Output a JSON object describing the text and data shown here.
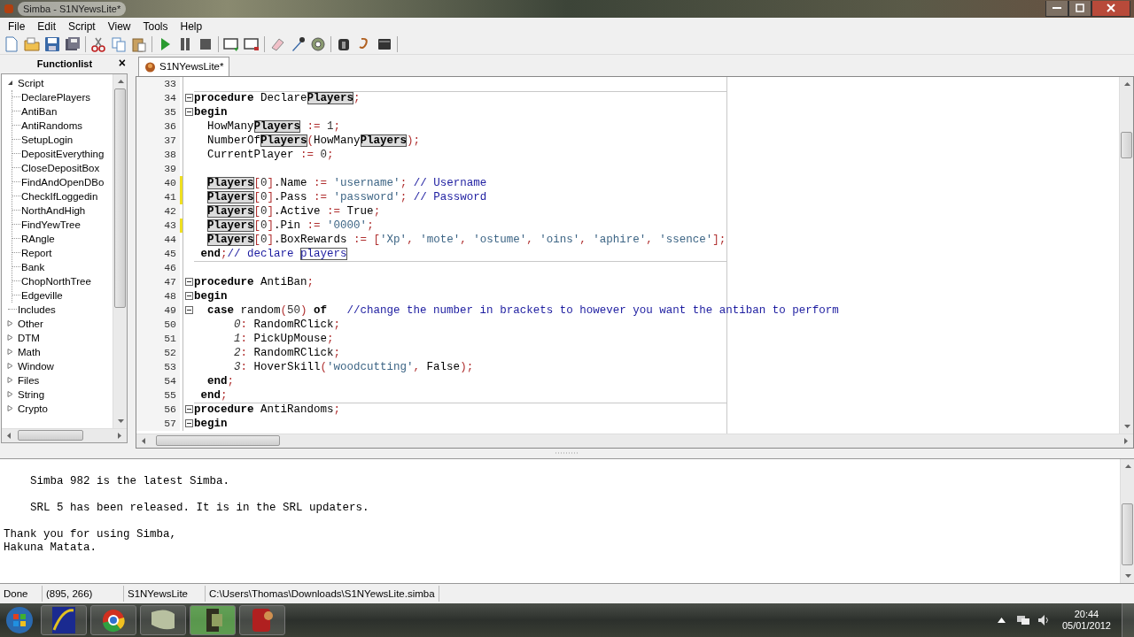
{
  "window": {
    "title": "Simba - S1NYewsLite*"
  },
  "menu": [
    "File",
    "Edit",
    "Script",
    "View",
    "Tools",
    "Help"
  ],
  "functionlist": {
    "title": "Functionlist",
    "close": "×",
    "items": [
      {
        "label": "Script",
        "kind": "folder",
        "expanded": true,
        "children": [
          {
            "label": "DeclarePlayers",
            "kind": "leaf"
          },
          {
            "label": "AntiBan",
            "kind": "leaf"
          },
          {
            "label": "AntiRandoms",
            "kind": "leaf"
          },
          {
            "label": "SetupLogin",
            "kind": "leaf"
          },
          {
            "label": "DepositEverything",
            "kind": "leaf"
          },
          {
            "label": "CloseDepositBox",
            "kind": "leaf"
          },
          {
            "label": "FindAndOpenDBo",
            "kind": "leaf"
          },
          {
            "label": "CheckIfLoggedin",
            "kind": "leaf"
          },
          {
            "label": "NorthAndHigh",
            "kind": "leaf"
          },
          {
            "label": "FindYewTree",
            "kind": "leaf"
          },
          {
            "label": "RAngle",
            "kind": "leaf"
          },
          {
            "label": "Report",
            "kind": "leaf"
          },
          {
            "label": "Bank",
            "kind": "leaf"
          },
          {
            "label": "ChopNorthTree",
            "kind": "leaf"
          },
          {
            "label": "Edgeville",
            "kind": "leaf"
          }
        ]
      },
      {
        "label": "Includes",
        "kind": "leaf"
      },
      {
        "label": "Other",
        "kind": "folder",
        "expanded": false
      },
      {
        "label": "DTM",
        "kind": "folder",
        "expanded": false
      },
      {
        "label": "Math",
        "kind": "folder",
        "expanded": false
      },
      {
        "label": "Window",
        "kind": "folder",
        "expanded": false
      },
      {
        "label": "Files",
        "kind": "folder",
        "expanded": false
      },
      {
        "label": "String",
        "kind": "folder",
        "expanded": false
      },
      {
        "label": "Crypto",
        "kind": "folder",
        "expanded": false
      }
    ]
  },
  "tabs": [
    {
      "label": "S1NYewsLite*",
      "selected": true
    }
  ],
  "lines": [
    {
      "n": "33",
      "fold": false,
      "modified": false,
      "divider": false
    },
    {
      "n": "34",
      "fold": true,
      "modified": false,
      "divider": true,
      "tokens": [
        {
          "kind": "kw",
          "text": "procedure"
        },
        {
          "kind": "id",
          "text": " Declare"
        },
        {
          "kind": "hl",
          "text": "Players"
        },
        {
          "kind": "sym",
          "text": ";"
        }
      ]
    },
    {
      "n": "35",
      "fold": true,
      "modified": false,
      "divider": false,
      "tokens": [
        {
          "kind": "kw",
          "text": "begin"
        }
      ]
    },
    {
      "n": "36",
      "fold": false,
      "modified": false,
      "divider": false,
      "tokens": [
        {
          "kind": "id",
          "text": "  HowMany"
        },
        {
          "kind": "hl",
          "text": "Players"
        },
        {
          "kind": "sym",
          "text": " := "
        },
        {
          "kind": "num",
          "text": "1"
        },
        {
          "kind": "sym",
          "text": ";"
        }
      ]
    },
    {
      "n": "37",
      "fold": false,
      "modified": false,
      "divider": false,
      "tokens": [
        {
          "kind": "id",
          "text": "  NumberOf"
        },
        {
          "kind": "hl",
          "text": "Players"
        },
        {
          "kind": "sym",
          "text": "("
        },
        {
          "kind": "id",
          "text": "HowMany"
        },
        {
          "kind": "hl",
          "text": "Players"
        },
        {
          "kind": "sym",
          "text": ");"
        }
      ]
    },
    {
      "n": "38",
      "fold": false,
      "modified": false,
      "divider": false,
      "tokens": [
        {
          "kind": "id",
          "text": "  CurrentPlayer"
        },
        {
          "kind": "sym",
          "text": " := "
        },
        {
          "kind": "num",
          "text": "0"
        },
        {
          "kind": "sym",
          "text": ";"
        }
      ]
    },
    {
      "n": "39",
      "fold": false,
      "modified": false,
      "divider": false
    },
    {
      "n": "40",
      "fold": false,
      "modified": true,
      "divider": false,
      "tokens": [
        {
          "kind": "hl",
          "text": "  Players"
        },
        {
          "kind": "sym",
          "text": "["
        },
        {
          "kind": "num",
          "text": "0"
        },
        {
          "kind": "sym",
          "text": "]"
        },
        {
          "kind": "id",
          "text": ".Name"
        },
        {
          "kind": "sym",
          "text": " := "
        },
        {
          "kind": "str",
          "text": "'username'"
        },
        {
          "kind": "sym",
          "text": ";"
        },
        {
          "kind": "cmt",
          "text": " // Username"
        }
      ]
    },
    {
      "n": "41",
      "fold": false,
      "modified": true,
      "divider": false,
      "tokens": [
        {
          "kind": "hl",
          "text": "  Players"
        },
        {
          "kind": "sym",
          "text": "["
        },
        {
          "kind": "num",
          "text": "0"
        },
        {
          "kind": "sym",
          "text": "]"
        },
        {
          "kind": "id",
          "text": ".Pass"
        },
        {
          "kind": "sym",
          "text": " := "
        },
        {
          "kind": "str",
          "text": "'password'"
        },
        {
          "kind": "sym",
          "text": ";"
        },
        {
          "kind": "cmt",
          "text": " // Password"
        }
      ]
    },
    {
      "n": "42",
      "fold": false,
      "modified": false,
      "divider": false,
      "tokens": [
        {
          "kind": "hl",
          "text": "  Players"
        },
        {
          "kind": "sym",
          "text": "["
        },
        {
          "kind": "num",
          "text": "0"
        },
        {
          "kind": "sym",
          "text": "]"
        },
        {
          "kind": "id",
          "text": ".Active"
        },
        {
          "kind": "sym",
          "text": " := "
        },
        {
          "kind": "id",
          "text": "True"
        },
        {
          "kind": "sym",
          "text": ";"
        }
      ]
    },
    {
      "n": "43",
      "fold": false,
      "modified": true,
      "divider": false,
      "tokens": [
        {
          "kind": "hl",
          "text": "  Players"
        },
        {
          "kind": "sym",
          "text": "["
        },
        {
          "kind": "num",
          "text": "0"
        },
        {
          "kind": "sym",
          "text": "]"
        },
        {
          "kind": "id",
          "text": ".Pin"
        },
        {
          "kind": "sym",
          "text": " := "
        },
        {
          "kind": "str",
          "text": "'0000'"
        },
        {
          "kind": "sym",
          "text": ";"
        }
      ]
    },
    {
      "n": "44",
      "fold": false,
      "modified": false,
      "divider": false,
      "tokens": [
        {
          "kind": "hl",
          "text": "  Players"
        },
        {
          "kind": "sym",
          "text": "["
        },
        {
          "kind": "num",
          "text": "0"
        },
        {
          "kind": "sym",
          "text": "]"
        },
        {
          "kind": "id",
          "text": ".BoxRewards"
        },
        {
          "kind": "sym",
          "text": " := ["
        },
        {
          "kind": "str",
          "text": "'Xp'"
        },
        {
          "kind": "sym",
          "text": ", "
        },
        {
          "kind": "str",
          "text": "'mote'"
        },
        {
          "kind": "sym",
          "text": ", "
        },
        {
          "kind": "str",
          "text": "'ostume'"
        },
        {
          "kind": "sym",
          "text": ", "
        },
        {
          "kind": "str",
          "text": "'oins'"
        },
        {
          "kind": "sym",
          "text": ", "
        },
        {
          "kind": "str",
          "text": "'aphire'"
        },
        {
          "kind": "sym",
          "text": ", "
        },
        {
          "kind": "str",
          "text": "'ssence'"
        },
        {
          "kind": "sym",
          "text": "];"
        }
      ]
    },
    {
      "n": "45",
      "fold": false,
      "modified": false,
      "divider": false,
      "tokens": [
        {
          "kind": "kw",
          "text": " end"
        },
        {
          "kind": "sym",
          "text": ";"
        },
        {
          "kind": "cmt",
          "text": "// declare "
        },
        {
          "kind": "hlc",
          "text": "players"
        }
      ]
    },
    {
      "n": "46",
      "fold": false,
      "modified": false,
      "divider": true
    },
    {
      "n": "47",
      "fold": true,
      "modified": false,
      "divider": false,
      "tokens": [
        {
          "kind": "kw",
          "text": "procedure"
        },
        {
          "kind": "id",
          "text": " AntiBan"
        },
        {
          "kind": "sym",
          "text": ";"
        }
      ]
    },
    {
      "n": "48",
      "fold": true,
      "modified": false,
      "divider": false,
      "tokens": [
        {
          "kind": "kw",
          "text": "begin"
        }
      ]
    },
    {
      "n": "49",
      "fold": true,
      "modified": false,
      "divider": false,
      "tokens": [
        {
          "kind": "kw",
          "text": "  case"
        },
        {
          "kind": "id",
          "text": " random"
        },
        {
          "kind": "sym",
          "text": "("
        },
        {
          "kind": "num",
          "text": "50"
        },
        {
          "kind": "sym",
          "text": ") "
        },
        {
          "kind": "kw",
          "text": "of"
        },
        {
          "kind": "cmt",
          "text": "   //change the number in brackets to however you want the antiban to perform"
        }
      ]
    },
    {
      "n": "50",
      "fold": false,
      "modified": false,
      "divider": false,
      "tokens": [
        {
          "kind": "lbl",
          "text": "      0"
        },
        {
          "kind": "sym",
          "text": ": "
        },
        {
          "kind": "id",
          "text": "RandomRClick"
        },
        {
          "kind": "sym",
          "text": ";"
        }
      ]
    },
    {
      "n": "51",
      "fold": false,
      "modified": false,
      "divider": false,
      "tokens": [
        {
          "kind": "lbl",
          "text": "      1"
        },
        {
          "kind": "sym",
          "text": ": "
        },
        {
          "kind": "id",
          "text": "PickUpMouse"
        },
        {
          "kind": "sym",
          "text": ";"
        }
      ]
    },
    {
      "n": "52",
      "fold": false,
      "modified": false,
      "divider": false,
      "tokens": [
        {
          "kind": "lbl",
          "text": "      2"
        },
        {
          "kind": "sym",
          "text": ": "
        },
        {
          "kind": "id",
          "text": "RandomRClick"
        },
        {
          "kind": "sym",
          "text": ";"
        }
      ]
    },
    {
      "n": "53",
      "fold": false,
      "modified": false,
      "divider": false,
      "tokens": [
        {
          "kind": "lbl",
          "text": "      3"
        },
        {
          "kind": "sym",
          "text": ": "
        },
        {
          "kind": "id",
          "text": "HoverSkill"
        },
        {
          "kind": "sym",
          "text": "("
        },
        {
          "kind": "str",
          "text": "'woodcutting'"
        },
        {
          "kind": "sym",
          "text": ", "
        },
        {
          "kind": "id",
          "text": "False"
        },
        {
          "kind": "sym",
          "text": ");"
        }
      ]
    },
    {
      "n": "54",
      "fold": false,
      "modified": false,
      "divider": false,
      "tokens": [
        {
          "kind": "kw",
          "text": "  end"
        },
        {
          "kind": "sym",
          "text": ";"
        }
      ]
    },
    {
      "n": "55",
      "fold": false,
      "modified": false,
      "divider": false,
      "tokens": [
        {
          "kind": "kw",
          "text": " end"
        },
        {
          "kind": "sym",
          "text": ";"
        }
      ]
    },
    {
      "n": "56",
      "fold": true,
      "modified": false,
      "divider": true,
      "tokens": [
        {
          "kind": "kw",
          "text": "procedure"
        },
        {
          "kind": "id",
          "text": " AntiRandoms"
        },
        {
          "kind": "sym",
          "text": ";"
        }
      ]
    },
    {
      "n": "57",
      "fold": true,
      "modified": false,
      "divider": false,
      "tokens": [
        {
          "kind": "kw",
          "text": "begin"
        }
      ]
    }
  ],
  "output": [
    [
      "    Simba 982 is the latest Simba."
    ],
    [
      "    SRL 5 has been released. It is in the SRL updaters."
    ],
    [
      "Thank you for using Simba,",
      "Hakuna Matata."
    ]
  ],
  "status_bar": [
    "Done",
    "(895, 266)",
    "S1NYewsLite",
    "C:\\Users\\Thomas\\Downloads\\S1NYewsLite.simba"
  ],
  "taskbar": {
    "time": "20:44",
    "date": "05/01/2012"
  }
}
